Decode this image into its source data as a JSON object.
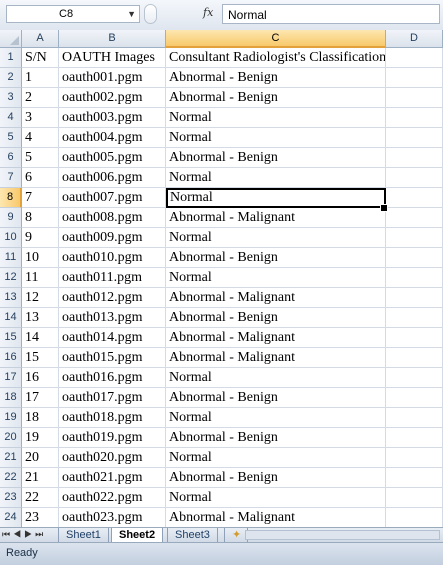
{
  "formula_bar": {
    "name_box": "C8",
    "fx_label": "fx",
    "formula_value": "Normal"
  },
  "columns": [
    "A",
    "B",
    "C",
    "D"
  ],
  "rows": [
    {
      "n": "1",
      "a": "S/N",
      "b": "OAUTH Images",
      "c": "Consultant Radiologist's Classification"
    },
    {
      "n": "2",
      "a": "1",
      "b": "oauth001.pgm",
      "c": "Abnormal - Benign"
    },
    {
      "n": "3",
      "a": "2",
      "b": "oauth002.pgm",
      "c": "Abnormal - Benign"
    },
    {
      "n": "4",
      "a": "3",
      "b": "oauth003.pgm",
      "c": "Normal"
    },
    {
      "n": "5",
      "a": "4",
      "b": "oauth004.pgm",
      "c": "Normal"
    },
    {
      "n": "6",
      "a": "5",
      "b": "oauth005.pgm",
      "c": "Abnormal - Benign"
    },
    {
      "n": "7",
      "a": "6",
      "b": "oauth006.pgm",
      "c": "Normal"
    },
    {
      "n": "8",
      "a": "7",
      "b": "oauth007.pgm",
      "c": "Normal"
    },
    {
      "n": "9",
      "a": "8",
      "b": "oauth008.pgm",
      "c": "Abnormal - Malignant"
    },
    {
      "n": "10",
      "a": "9",
      "b": "oauth009.pgm",
      "c": "Normal"
    },
    {
      "n": "11",
      "a": "10",
      "b": "oauth010.pgm",
      "c": "Abnormal - Benign"
    },
    {
      "n": "12",
      "a": "11",
      "b": "oauth011.pgm",
      "c": "Normal"
    },
    {
      "n": "13",
      "a": "12",
      "b": "oauth012.pgm",
      "c": "Abnormal - Malignant"
    },
    {
      "n": "14",
      "a": "13",
      "b": "oauth013.pgm",
      "c": "Abnormal - Benign"
    },
    {
      "n": "15",
      "a": "14",
      "b": "oauth014.pgm",
      "c": "Abnormal - Malignant"
    },
    {
      "n": "16",
      "a": "15",
      "b": "oauth015.pgm",
      "c": "Abnormal - Malignant"
    },
    {
      "n": "17",
      "a": "16",
      "b": "oauth016.pgm",
      "c": "Normal"
    },
    {
      "n": "18",
      "a": "17",
      "b": "oauth017.pgm",
      "c": "Abnormal - Benign"
    },
    {
      "n": "19",
      "a": "18",
      "b": "oauth018.pgm",
      "c": "Normal"
    },
    {
      "n": "20",
      "a": "19",
      "b": "oauth019.pgm",
      "c": "Abnormal - Benign"
    },
    {
      "n": "21",
      "a": "20",
      "b": "oauth020.pgm",
      "c": "Normal"
    },
    {
      "n": "22",
      "a": "21",
      "b": "oauth021.pgm",
      "c": "Abnormal - Benign"
    },
    {
      "n": "23",
      "a": "22",
      "b": "oauth022.pgm",
      "c": "Normal"
    },
    {
      "n": "24",
      "a": "23",
      "b": "oauth023.pgm",
      "c": "Abnormal - Malignant"
    }
  ],
  "selected_cell": {
    "row": 8,
    "col": "C"
  },
  "sheet_tabs": [
    "Sheet1",
    "Sheet2",
    "Sheet3"
  ],
  "active_sheet": "Sheet2",
  "status": "Ready",
  "colors": {
    "header_bg": "#dbe2eb",
    "active_header": "#f8c96b",
    "gridline": "#d4dbe4",
    "tab_text": "#1f3f66"
  }
}
